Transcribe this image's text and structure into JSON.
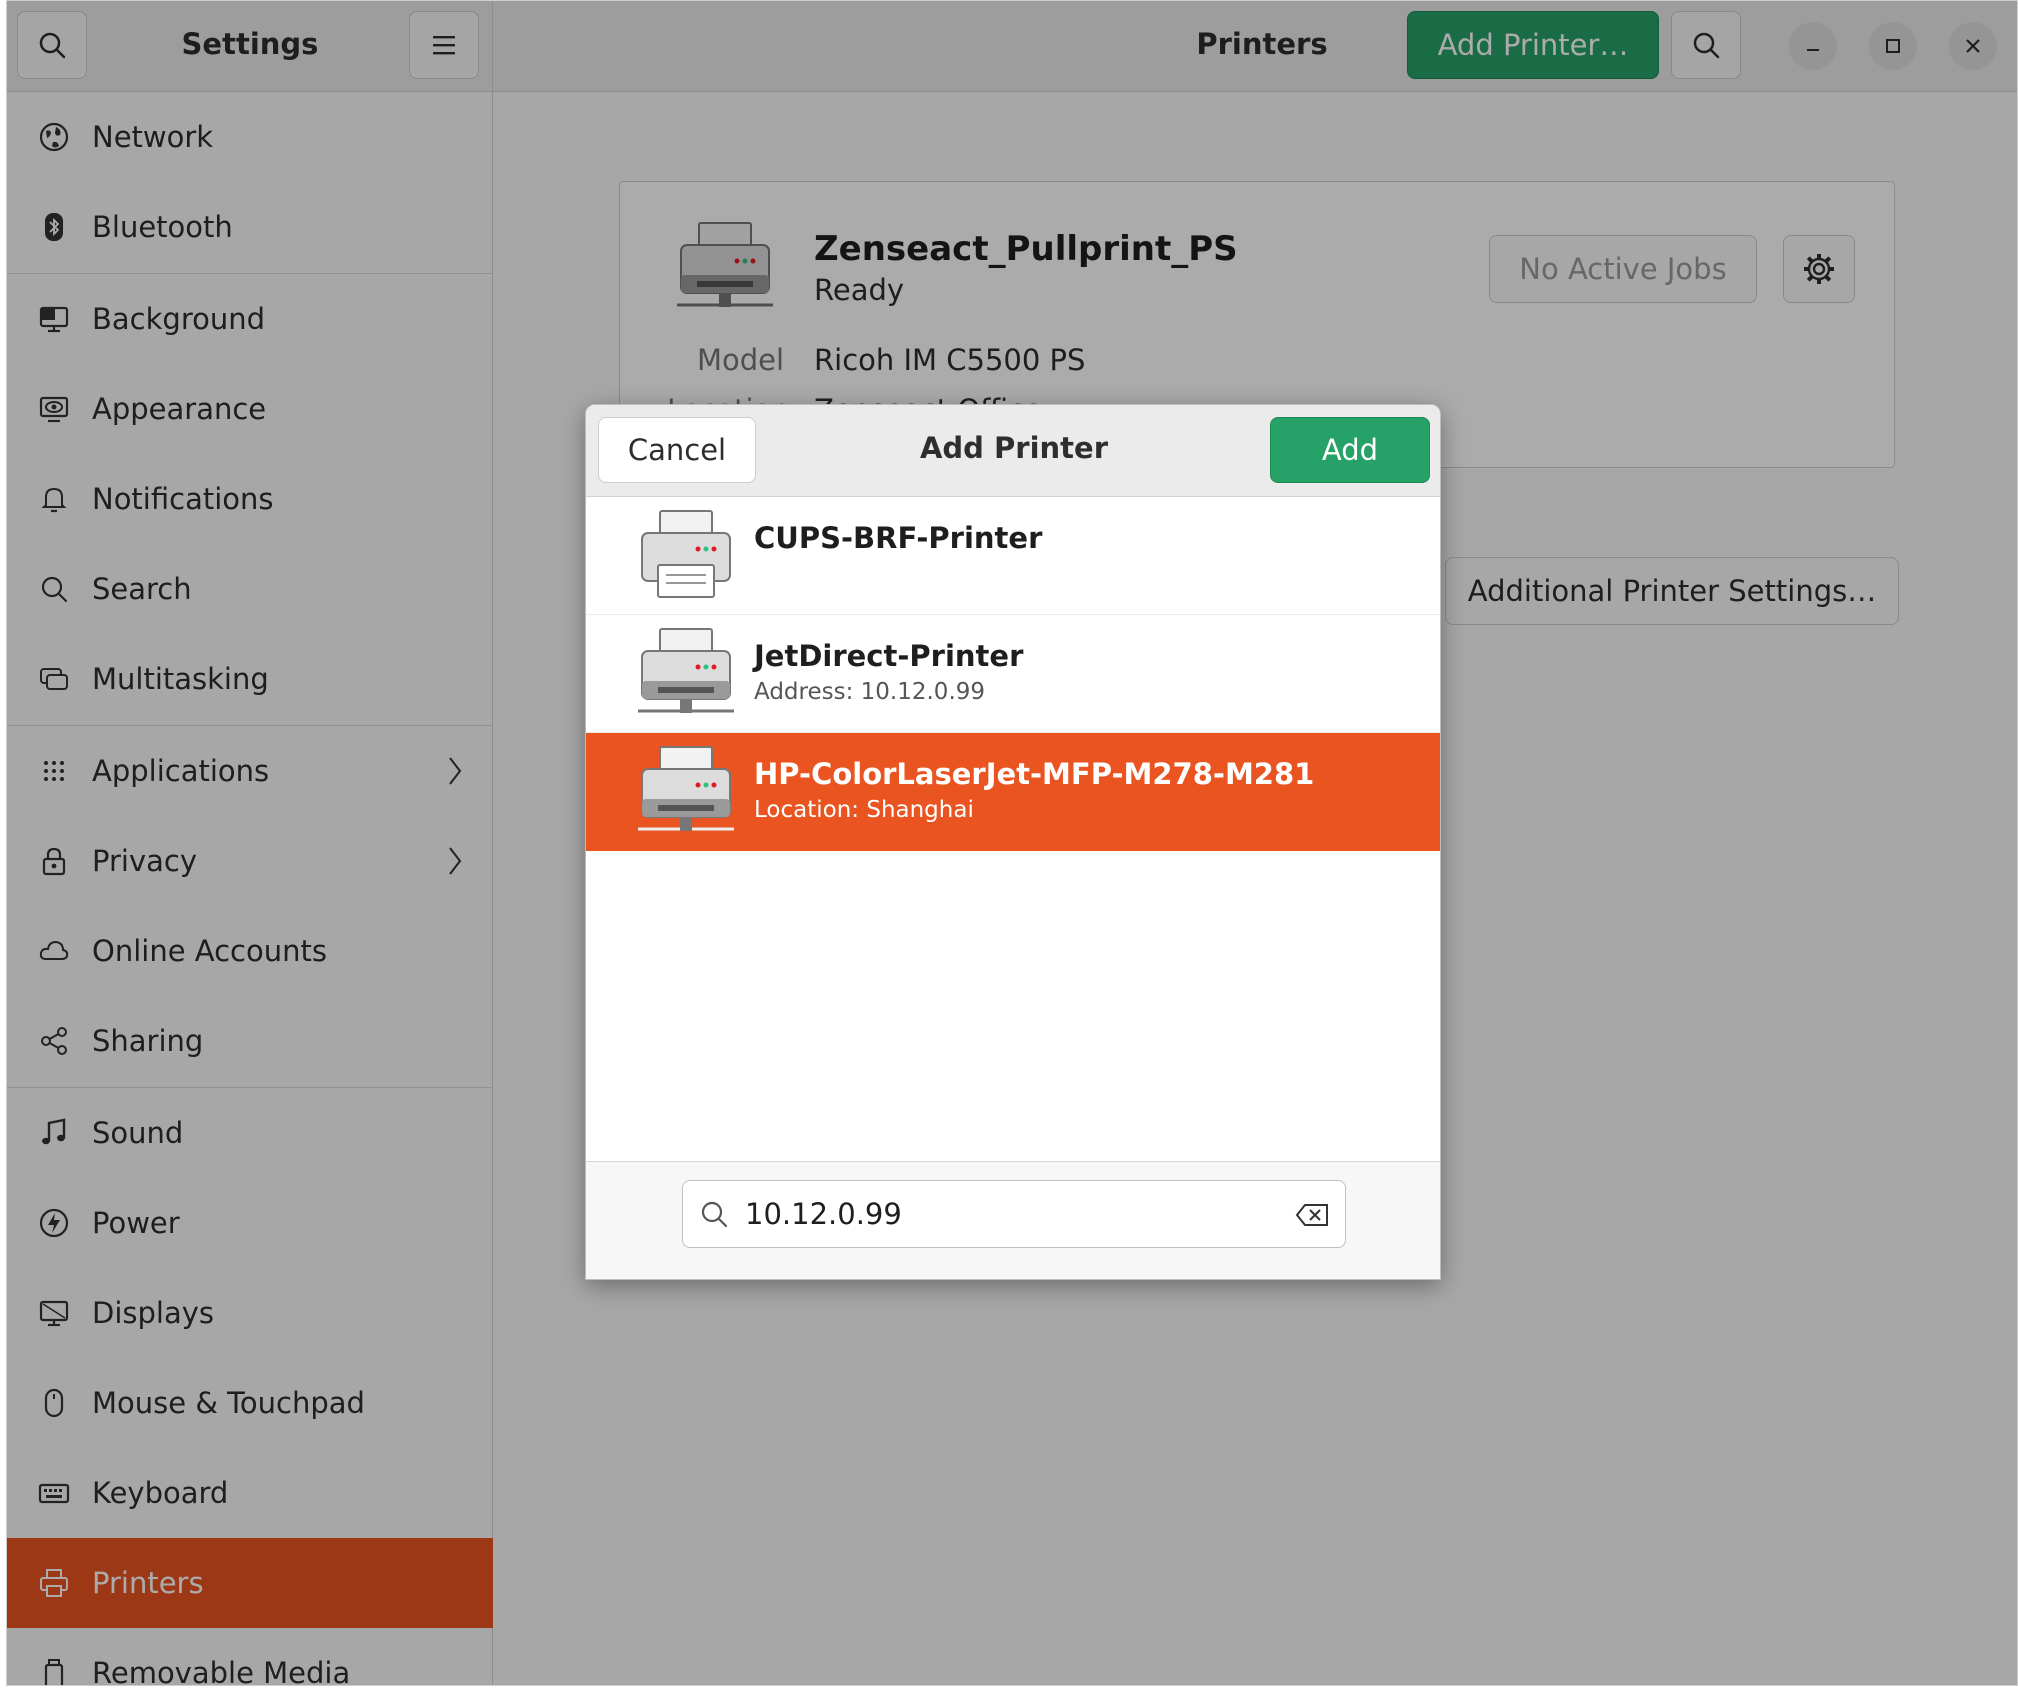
{
  "header": {
    "sidebar_title": "Settings",
    "page_title": "Printers",
    "add_printer_label": "Add Printer…"
  },
  "sidebar": {
    "items": [
      {
        "label": "Network",
        "icon": "network-icon"
      },
      {
        "label": "Bluetooth",
        "icon": "bluetooth-icon"
      },
      {
        "label": "Background",
        "icon": "background-icon"
      },
      {
        "label": "Appearance",
        "icon": "appearance-icon"
      },
      {
        "label": "Notifications",
        "icon": "bell-icon"
      },
      {
        "label": "Search",
        "icon": "search-icon"
      },
      {
        "label": "Multitasking",
        "icon": "multitasking-icon"
      },
      {
        "label": "Applications",
        "icon": "grid-icon"
      },
      {
        "label": "Privacy",
        "icon": "lock-icon"
      },
      {
        "label": "Online Accounts",
        "icon": "cloud-icon"
      },
      {
        "label": "Sharing",
        "icon": "share-icon"
      },
      {
        "label": "Sound",
        "icon": "music-note-icon"
      },
      {
        "label": "Power",
        "icon": "power-icon"
      },
      {
        "label": "Displays",
        "icon": "display-icon"
      },
      {
        "label": "Mouse & Touchpad",
        "icon": "mouse-icon"
      },
      {
        "label": "Keyboard",
        "icon": "keyboard-icon"
      },
      {
        "label": "Printers",
        "icon": "printer-icon",
        "active": true
      },
      {
        "label": "Removable Media",
        "icon": "removable-media-icon"
      }
    ]
  },
  "printer_card": {
    "name": "Zenseact_Pullprint_PS",
    "status": "Ready",
    "model_label": "Model",
    "model_value": "Ricoh IM C5500 PS",
    "location_label": "Location",
    "location_value": "Zenseact Office",
    "jobs_label": "No Active Jobs"
  },
  "additional_settings_label": "Additional Printer Settings…",
  "dialog": {
    "title": "Add Printer",
    "cancel_label": "Cancel",
    "add_label": "Add",
    "printers": [
      {
        "name": "CUPS-BRF-Printer",
        "detail": ""
      },
      {
        "name": "JetDirect-Printer",
        "detail": "Address: 10.12.0.99"
      },
      {
        "name": "HP-ColorLaserJet-MFP-M278-M281",
        "detail": "Location: Shanghai",
        "selected": true
      }
    ],
    "search_value": "10.12.0.99"
  },
  "colors": {
    "accent": "#e95420",
    "suggested": "#26a269"
  }
}
